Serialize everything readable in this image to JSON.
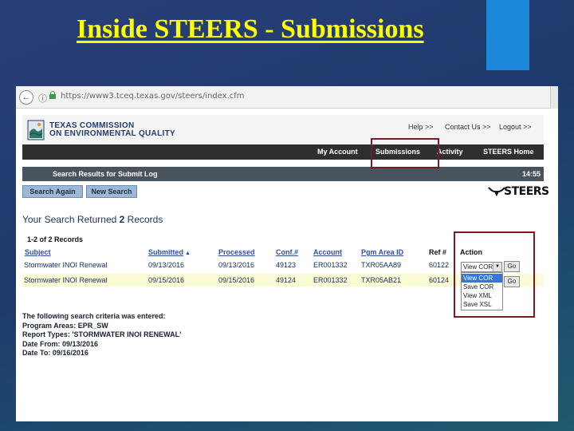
{
  "slide": {
    "title": "Inside STEERS - Submissions"
  },
  "browser": {
    "url": "https://www3.tceq.texas.gov/steers/index.cfm"
  },
  "site": {
    "logo_line1": "TEXAS COMMISSION",
    "logo_line2": "ON ENVIRONMENTAL QUALITY",
    "top_links": [
      "Help >>",
      "Contact Us >>",
      "Logout >>"
    ],
    "nav_items": [
      "My Account",
      "Submissions",
      "Activity",
      "STEERS Home"
    ],
    "results_title": "Search Results for Submit Log",
    "time": "14:55",
    "search_again_label": "Search Again",
    "new_search_label": "New Search",
    "steers_logo_text": "STEERS"
  },
  "results": {
    "summary_prefix": "Your Search Returned ",
    "summary_count": "2",
    "summary_suffix": " Records",
    "record_range": "1-2  of  2  Records",
    "columns": [
      "Subject",
      "Submitted",
      "Processed",
      "Conf.#",
      "Account",
      "Pgm Area ID",
      "Ref #",
      "Action"
    ],
    "rows": [
      [
        "Stormwater INOI Renewal",
        "09/13/2016",
        "09/13/2016",
        "49123",
        "ER001332",
        "TXR05AA89",
        "60122"
      ],
      [
        "Stormwater INOI Renewal",
        "09/15/2016",
        "09/15/2016",
        "49124",
        "ER001332",
        "TXR05AB21",
        "60124"
      ]
    ],
    "action_selected": "View COR",
    "go_label": "Go",
    "action_options": [
      "View COR",
      "Save COR",
      "View XML",
      "Save XSL"
    ]
  },
  "criteria": {
    "heading": "The following search criteria was entered:",
    "lines": [
      "Program Areas: EPR_SW",
      "Report Types: 'STORMWATER INOI RENEWAL'",
      "Date From: 09/13/2016",
      "Date To: 09/16/2016"
    ]
  },
  "colors": {
    "title": "#ffff00",
    "highlight": "#7a1a24",
    "nav": "#2f2f2f",
    "link": "#2d4fa0"
  }
}
